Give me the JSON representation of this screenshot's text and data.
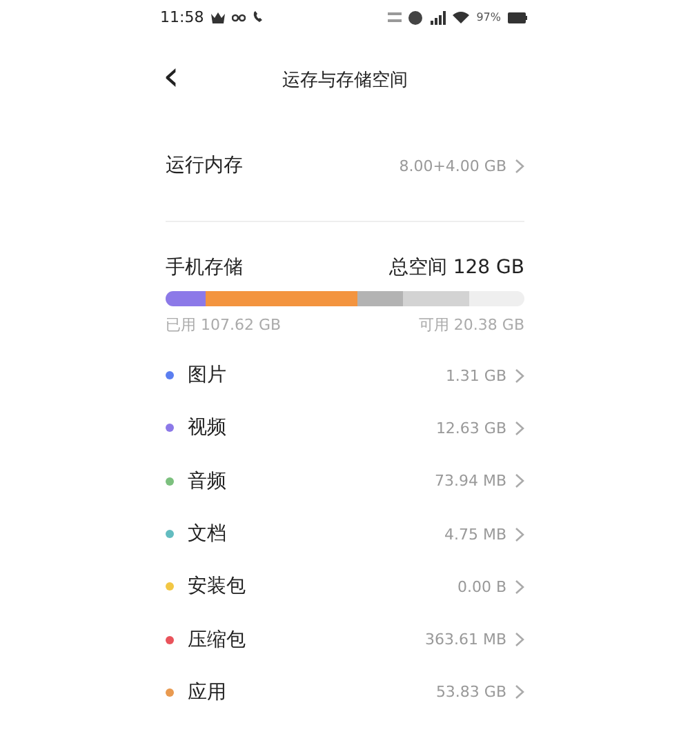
{
  "status_bar": {
    "time": "11:58",
    "battery": "97%"
  },
  "header": {
    "back": "‹",
    "title": "运存与存储空间"
  },
  "memory": {
    "label": "运行内存",
    "value": "8.00+4.00 GB"
  },
  "storage": {
    "title": "手机存储",
    "total": "总空间 128 GB",
    "segments": [
      {
        "color": "#8c79e8"
      },
      {
        "color": "#f3943f"
      },
      {
        "color": "#b3b3b3"
      },
      {
        "color": "#d3d3d3"
      }
    ],
    "used": "已用 107.62 GB",
    "free": "可用 20.38 GB"
  },
  "categories": [
    {
      "name": "图片",
      "size": "1.31 GB",
      "color": "#5b7ef0"
    },
    {
      "name": "视频",
      "size": "12.63 GB",
      "color": "#8c79e8"
    },
    {
      "name": "音频",
      "size": "73.94 MB",
      "color": "#7cc07e"
    },
    {
      "name": "文档",
      "size": "4.75 MB",
      "color": "#63bcc0"
    },
    {
      "name": "安装包",
      "size": "0.00 B",
      "color": "#f2c744"
    },
    {
      "name": "压缩包",
      "size": "363.61 MB",
      "color": "#e9535b"
    },
    {
      "name": "应用",
      "size": "53.83 GB",
      "color": "#e99a50"
    }
  ]
}
